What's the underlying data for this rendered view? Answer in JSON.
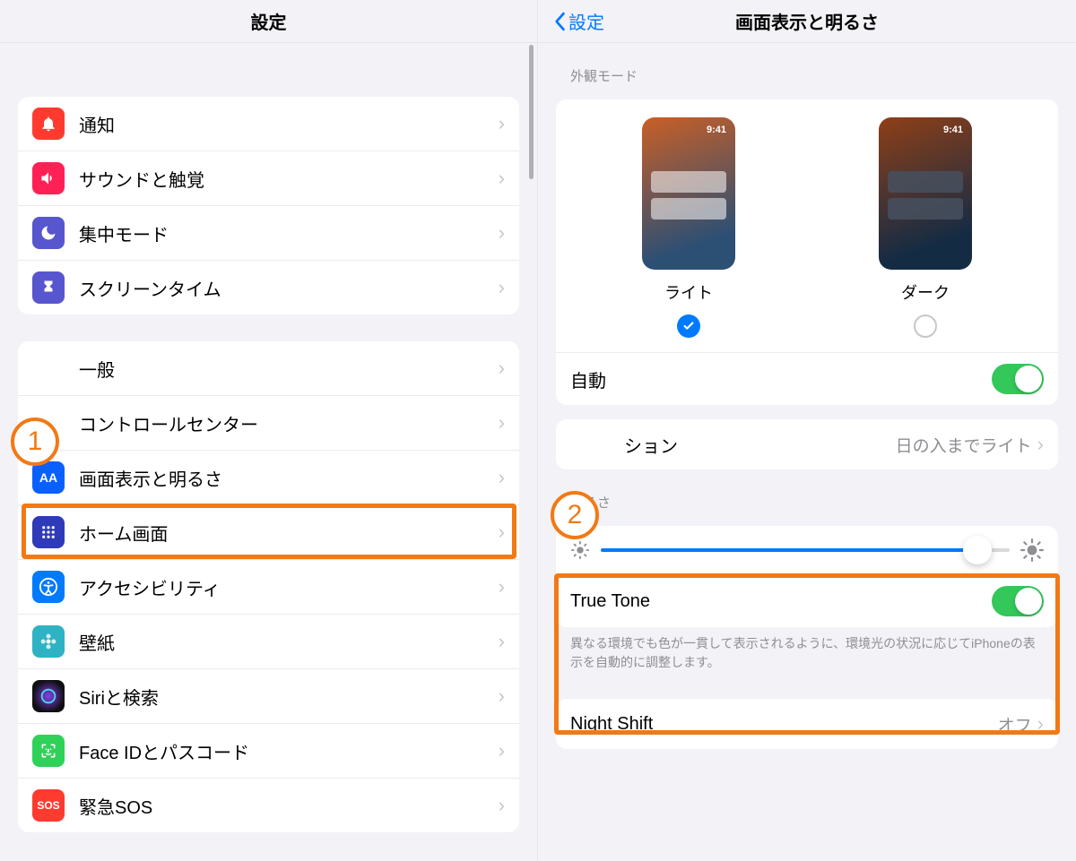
{
  "left": {
    "title": "設定",
    "group1": [
      {
        "key": "notifications",
        "label": "通知",
        "bg": "#ff3b30"
      },
      {
        "key": "sounds",
        "label": "サウンドと触覚",
        "bg": "#ff2156"
      },
      {
        "key": "focus",
        "label": "集中モード",
        "bg": "#5756ce"
      },
      {
        "key": "screentime",
        "label": "スクリーンタイム",
        "bg": "#5756ce"
      }
    ],
    "group2": [
      {
        "key": "general",
        "label": "一般",
        "bg": "#e5e5ea",
        "gear": true
      },
      {
        "key": "control-center",
        "label": "コントロールセンター",
        "bg": "#e5e5ea",
        "gear": true
      },
      {
        "key": "display-brightness",
        "label": "画面表示と明るさ",
        "bg": "#0a60ff"
      },
      {
        "key": "home-screen",
        "label": "ホーム画面",
        "bg": "#2f3ab8"
      },
      {
        "key": "accessibility",
        "label": "アクセシビリティ",
        "bg": "#007aff"
      },
      {
        "key": "wallpaper",
        "label": "壁紙",
        "bg": "#2fb3c4"
      },
      {
        "key": "siri",
        "label": "Siriと検索",
        "bg": "#141414"
      },
      {
        "key": "faceid",
        "label": "Face IDとパスコード",
        "bg": "#30d158"
      },
      {
        "key": "sos",
        "label": "緊急SOS",
        "bg": "#ff3b30"
      }
    ]
  },
  "right": {
    "back": "設定",
    "title": "画面表示と明るさ",
    "appearance_header": "外観モード",
    "preview_time": "9:41",
    "light_label": "ライト",
    "dark_label": "ダーク",
    "automatic_label": "自動",
    "options_label_suffix": "ション",
    "options_value": "日の入までライト",
    "brightness_header": "明るさ",
    "truetone_label": "True Tone",
    "truetone_footer": "異なる環境でも色が一貫して表示されるように、環境光の状況に応じてiPhoneの表示を自動的に調整します。",
    "nightshift_label": "Night Shift",
    "nightshift_value": "オフ"
  },
  "annotations": {
    "step1": "1",
    "step2": "2"
  }
}
